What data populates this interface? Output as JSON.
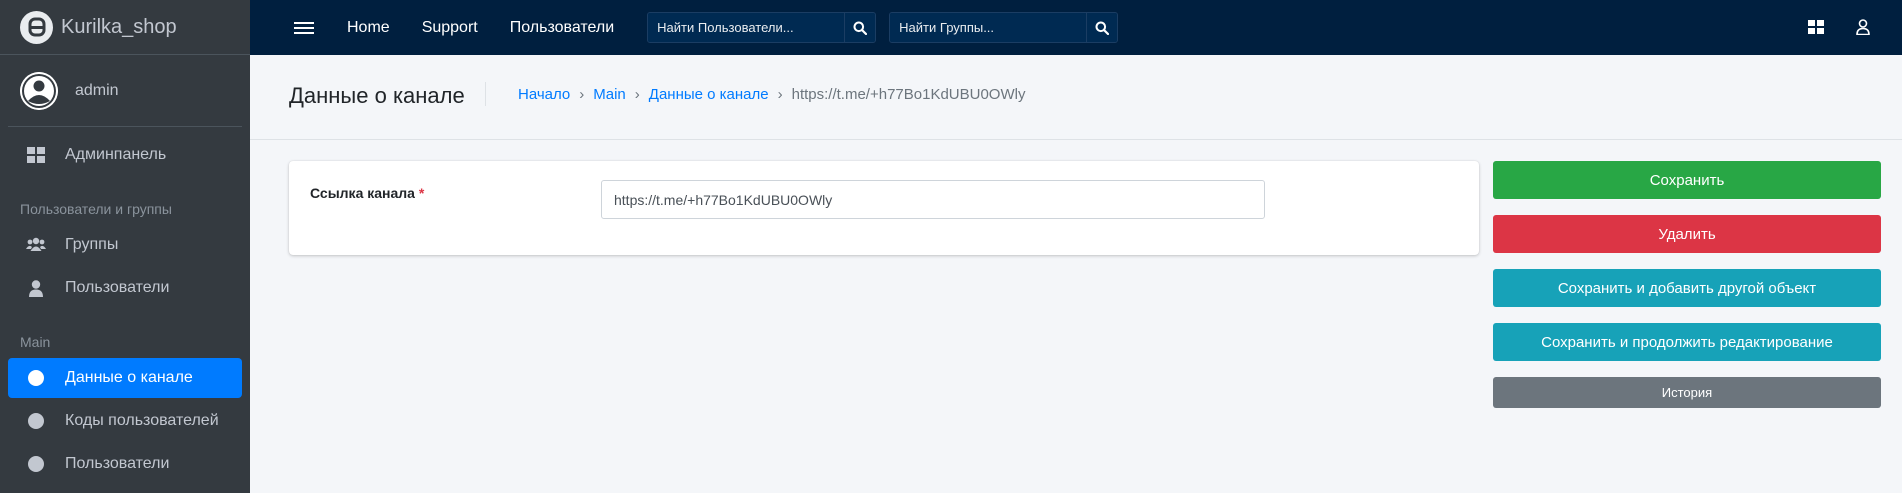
{
  "sidebar": {
    "brand": "Kurilka_shop",
    "user": "admin",
    "items": [
      {
        "label": "Админпанель"
      },
      {
        "header": "Пользователи и группы"
      },
      {
        "label": "Группы"
      },
      {
        "label": "Пользователи"
      },
      {
        "header": "Main"
      },
      {
        "label": "Данные о канале",
        "active": true
      },
      {
        "label": "Коды пользователей"
      },
      {
        "label": "Пользователи"
      }
    ]
  },
  "topbar": {
    "links": [
      "Home",
      "Support",
      "Пользователи"
    ],
    "search_users_placeholder": "Найти Пользователи...",
    "search_groups_placeholder": "Найти Группы..."
  },
  "header": {
    "title": "Данные о канале",
    "breadcrumb": [
      "Начало",
      "Main",
      "Данные о канале"
    ],
    "breadcrumb_current": "https://t.me/+h77Bo1KdUBU0OWly"
  },
  "form": {
    "label": "Ссылка канала",
    "required_mark": "*",
    "value": "https://t.me/+h77Bo1KdUBU0OWly"
  },
  "actions": {
    "save": "Сохранить",
    "delete": "Удалить",
    "save_add": "Сохранить и добавить другой объект",
    "save_continue": "Сохранить и продолжить редактирование",
    "history": "История"
  },
  "colors": {
    "sidebar_bg": "#343a40",
    "topbar_bg": "#001f3f",
    "active": "#007bff",
    "success": "#28a745",
    "danger": "#dc3545",
    "info": "#17a2b8",
    "secondary": "#6c757d"
  }
}
